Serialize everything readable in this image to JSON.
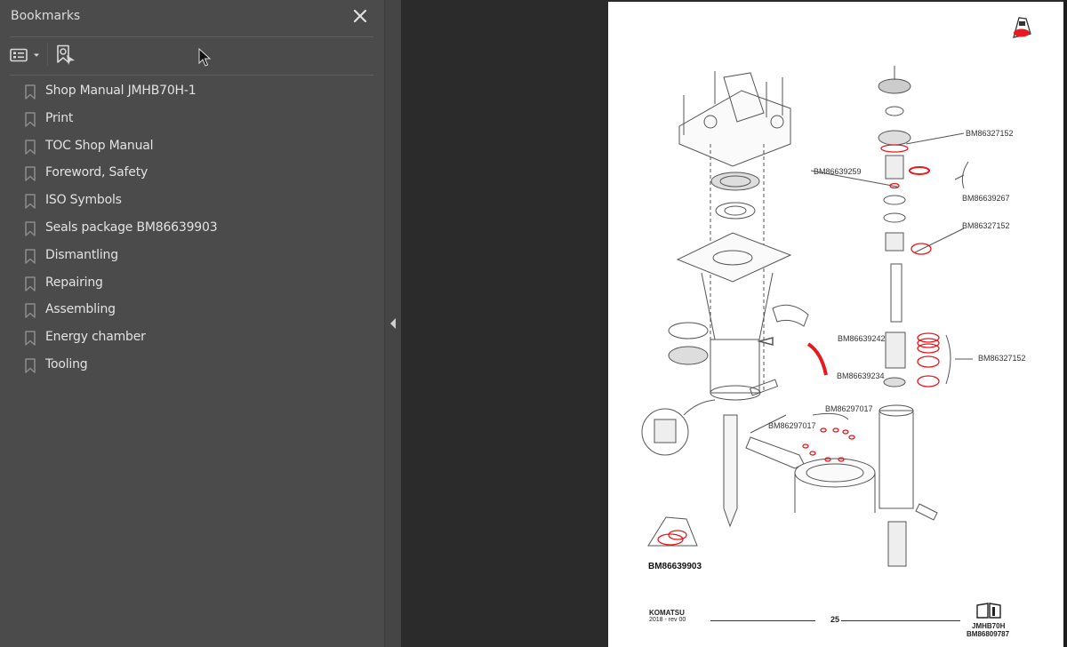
{
  "bookmarks_panel": {
    "title": "Bookmarks",
    "toolbar": {
      "options_icon": "list-options-icon",
      "find_bookmark_icon": "find-current-bookmark-icon"
    },
    "items": [
      {
        "label": "Shop Manual JMHB70H-1"
      },
      {
        "label": "Print"
      },
      {
        "label": "TOC Shop Manual"
      },
      {
        "label": "Foreword, Safety"
      },
      {
        "label": "ISO Symbols"
      },
      {
        "label": "Seals package BM86639903"
      },
      {
        "label": "Dismantling"
      },
      {
        "label": "Repairing"
      },
      {
        "label": "Assembling"
      },
      {
        "label": "Energy chamber"
      },
      {
        "label": "Tooling"
      }
    ]
  },
  "document_page": {
    "part_labels": {
      "bm86327152_top": "BM86327152",
      "bm86639259": "BM86639259",
      "bm86639267": "BM86639267",
      "bm86327152_mid": "BM86327152",
      "bm86639242": "BM86639242",
      "bm86327152_right": "BM86327152",
      "bm86639234": "BM86639234",
      "bm86297017_a": "BM86297017",
      "bm86297017_b": "BM86297017",
      "seal_package": "BM86639903"
    },
    "footer": {
      "brand": "KOMATSU",
      "revision": "2018 -  rev 00",
      "page_number": "25",
      "model": "JMHB70H",
      "doc_code": "BM86809787"
    },
    "colors": {
      "seal_red": "#e8191e",
      "line_gray": "#555555"
    }
  }
}
